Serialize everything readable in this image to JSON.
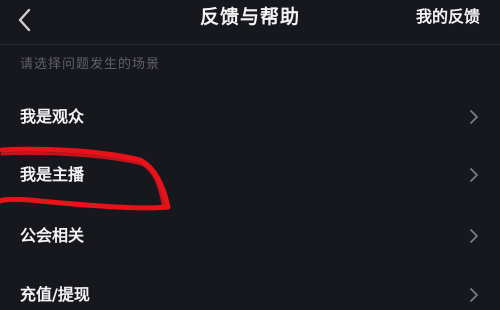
{
  "header": {
    "title": "反馈与帮助",
    "right_action": "我的反馈",
    "back_icon": "chevron-left-icon"
  },
  "section": {
    "label": "请选择问题发生的场景"
  },
  "menu": {
    "items": [
      {
        "label": "我是观众",
        "icon": "chevron-right-icon"
      },
      {
        "label": "我是主播",
        "icon": "chevron-right-icon"
      },
      {
        "label": "公会相关",
        "icon": "chevron-right-icon"
      },
      {
        "label": "充值/提现",
        "icon": "chevron-right-icon"
      }
    ]
  },
  "colors": {
    "background": "#17181d",
    "text": "#f3f3f3",
    "muted": "#5f6068",
    "annotation": "#e8121b"
  }
}
